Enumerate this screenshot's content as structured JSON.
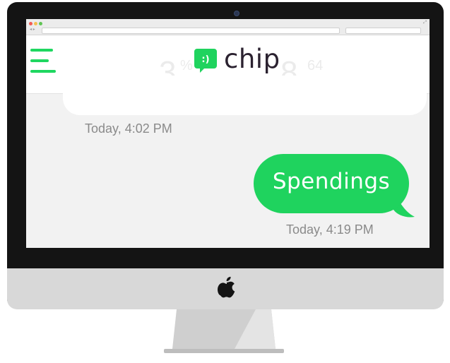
{
  "app": {
    "name": "chip",
    "brand_color": "#1fd35e",
    "logo_icon": "chat-bubble-smiley-icon",
    "logo_glyph": ":)"
  },
  "header": {
    "menu_icon": "hamburger-menu-icon",
    "background_digits": {
      "left": "3",
      "left_small": "%",
      "right": "8",
      "right_small": "64"
    }
  },
  "conversation": {
    "first_timestamp": "Today, 4:02 PM",
    "sent_message": {
      "text": "Spendings",
      "timestamp": "Today, 4:19 PM"
    }
  }
}
